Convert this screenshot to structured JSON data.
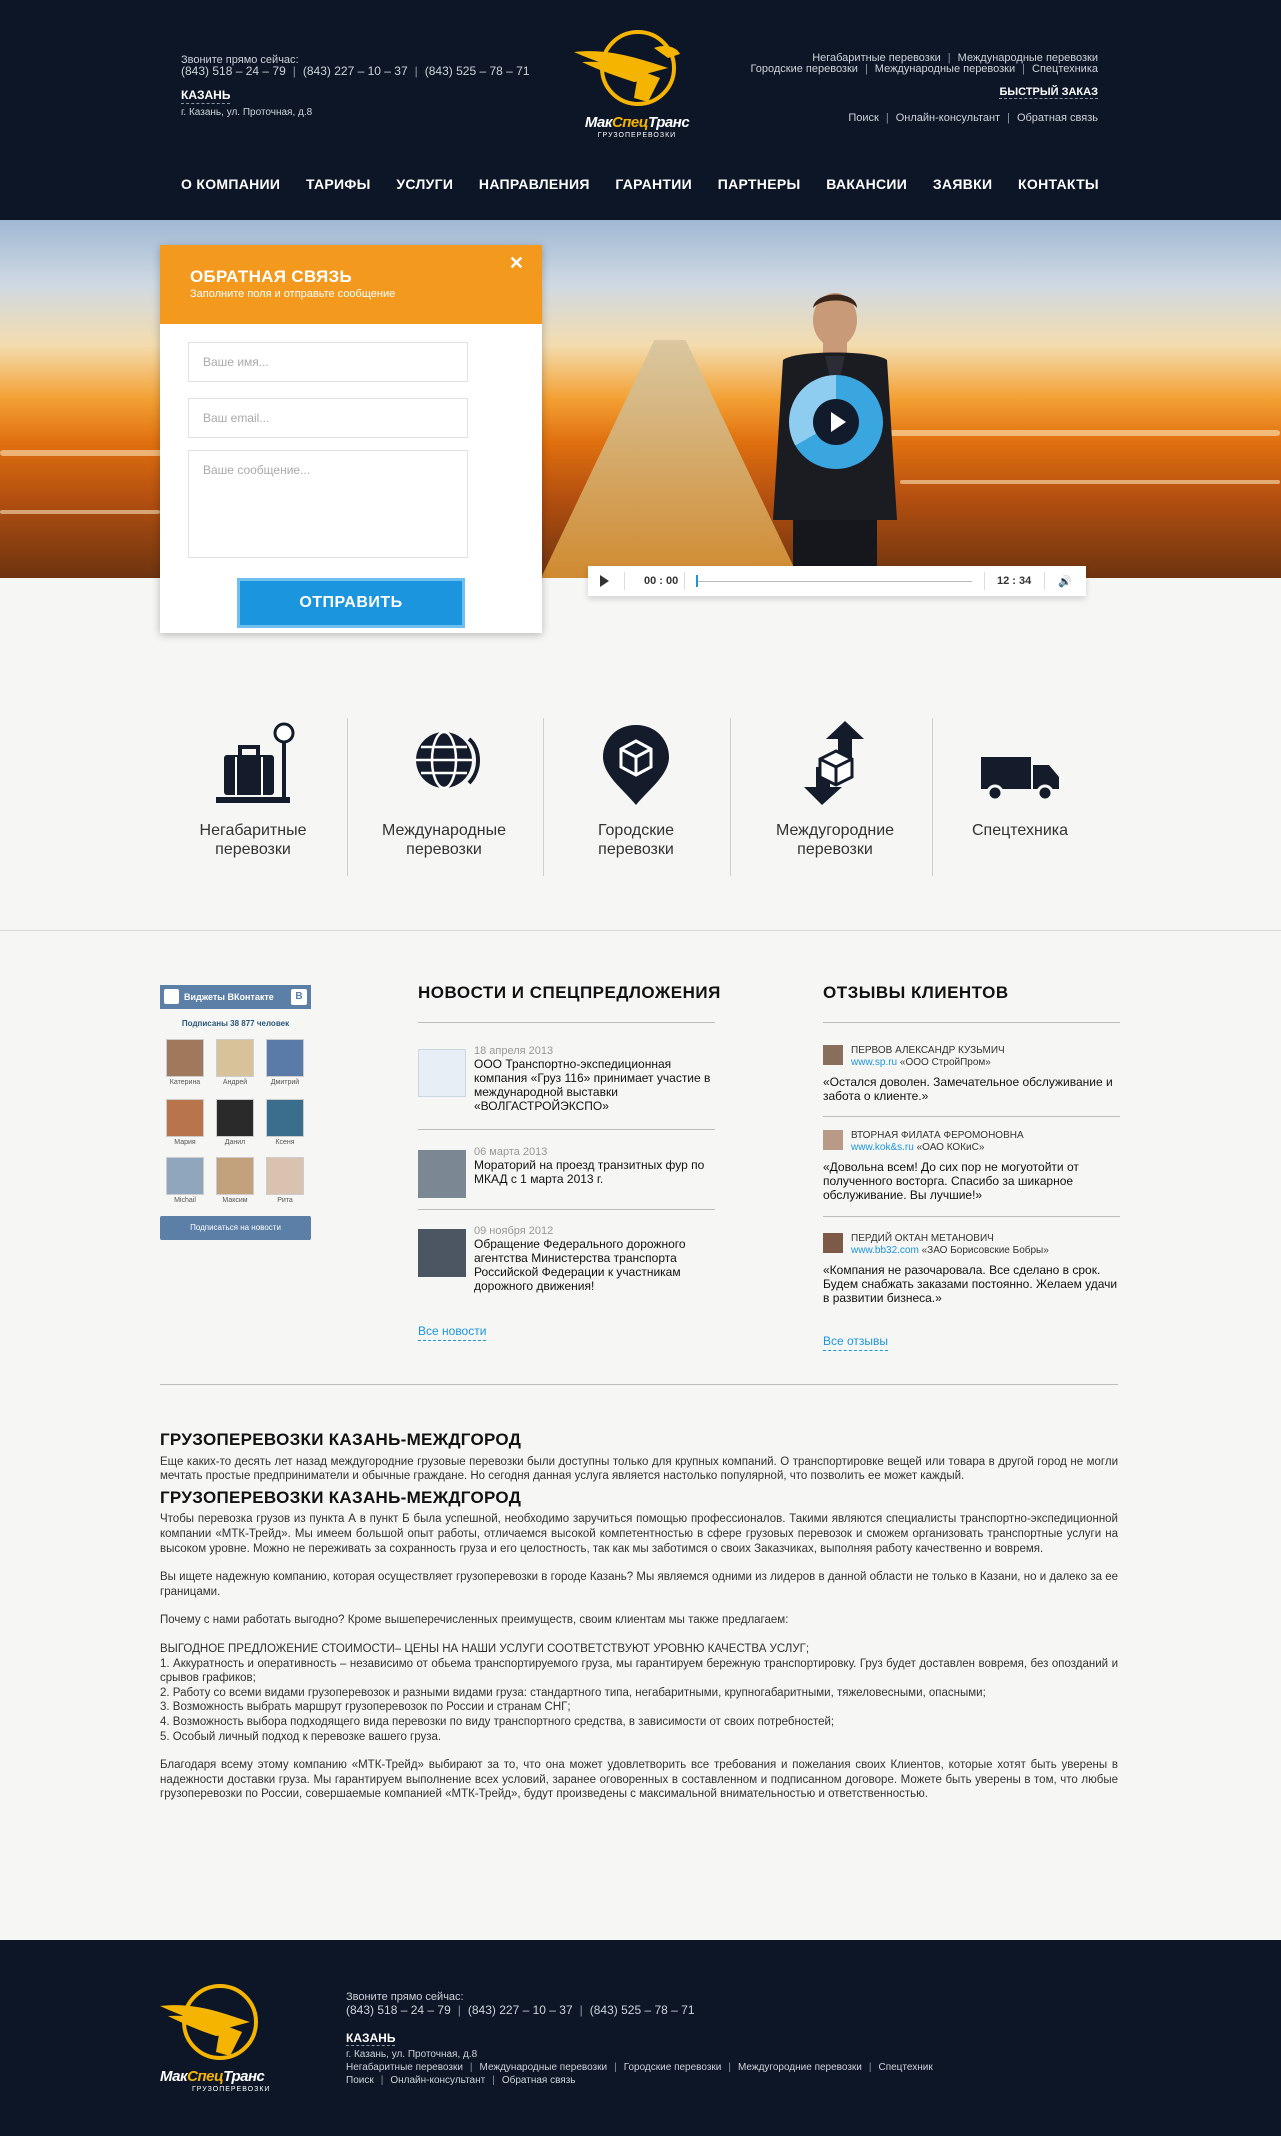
{
  "header": {
    "call_label": "Звоните прямо сейчас:",
    "phones": [
      "(843) 518 – 24 – 79",
      "(843) 227 – 10 – 37",
      "(843) 525 – 78 – 71"
    ],
    "city": "КАЗАНЬ",
    "address": "г. Казань, ул. Проточная, д.8",
    "logo": {
      "part1": "Мак",
      "part2": "Спец",
      "part3": "Транс",
      "sub": "ГРУЗОПЕРЕВОЗКИ"
    },
    "top_links_row1": [
      "Негабаритные перевозки",
      "Международные перевозки"
    ],
    "top_links_row2": [
      "Городские перевозки",
      "Международные перевозки",
      "Спецтехника"
    ],
    "quick_order": "БЫСТРЫЙ ЗАКАЗ",
    "top_links_row3": [
      "Поиск",
      "Онлайн-консультант",
      "Обратная связь"
    ]
  },
  "nav": [
    "О КОМПАНИИ",
    "ТАРИФЫ",
    "УСЛУГИ",
    "НАПРАВЛЕНИЯ",
    "ГАРАНТИИ",
    "ПАРТНЕРЫ",
    "ВАКАНСИИ",
    "ЗАЯВКИ",
    "КОНТАКТЫ"
  ],
  "feedback": {
    "title": "ОБРАТНАЯ СВЯЗЬ",
    "subtitle": "Заполните поля и отправьте сообщение",
    "name_placeholder": "Ваше имя...",
    "email_placeholder": "Ваш email...",
    "message_placeholder": "Ваше сообщение...",
    "send_label": "ОТПРАВИТЬ",
    "close_icon": "close-icon"
  },
  "player": {
    "current": "00 : 00",
    "total": "12 : 34",
    "progress": 0.0
  },
  "services": [
    {
      "label1": "Негабаритные",
      "label2": "перевозки",
      "icon": "luggage-scale-icon"
    },
    {
      "label1": "Международные",
      "label2": "перевозки",
      "icon": "globe-icon"
    },
    {
      "label1": "Городские",
      "label2": "перевозки",
      "icon": "map-pin-box-icon"
    },
    {
      "label1": "Междугородние",
      "label2": "перевозки",
      "icon": "box-arrows-icon"
    },
    {
      "label1": "Спецтехника",
      "label2": "",
      "icon": "truck-icon"
    }
  ],
  "vk": {
    "title": "Виджеты ВКонтакте",
    "count": "Подписаны 38 877 человек",
    "users": [
      "Катерина",
      "Андрей",
      "Дмитрий",
      "Мария",
      "Данил",
      "Ксеня",
      "Michail",
      "Максим",
      "Рита"
    ],
    "subscribe": "Подписаться на новости"
  },
  "news": {
    "title": "НОВОСТИ И СПЕЦПРЕДЛОЖЕНИЯ",
    "items": [
      {
        "date": "18 апреля 2013",
        "text": "ООО Транспортно-экспедиционная компания «Груз 116» принимает участие в международной выставки «ВОЛГАСТРОЙЭКСПО»"
      },
      {
        "date": "06 марта 2013",
        "text": "Мораторий на проезд транзитных фур по МКАД с 1 марта 2013 г."
      },
      {
        "date": "09 ноября 2012",
        "text": "Обращение Федерального дорожного агентства Министерства транспорта Российской Федерации к участникам дорожного движения!"
      }
    ],
    "all_link": "Все новости"
  },
  "reviews": {
    "title": "ОТЗЫВЫ КЛИЕНТОВ",
    "items": [
      {
        "name": "ПЕРВОВ АЛЕКСАНДР КУЗЬМИЧ",
        "site": "www.sp.ru",
        "company": "«ООО СтройПром»",
        "text": "«Остался доволен. Замечательное обслуживание и забота о клиенте.»"
      },
      {
        "name": "ВТОРНАЯ ФИЛАТА ФЕРОМОНОВНА",
        "site": "www.kok&s.ru",
        "company": "«ОАО КОКиС»",
        "text": "«Довольна всем! До сих пор не могуотойти от полученного восторга. Спасибо за шикарное обслуживание. Вы лучшие!»"
      },
      {
        "name": "ПЕРДИЙ ОКТАН МЕТАНОВИЧ",
        "site": "www.bb32.com",
        "company": "«ЗАО Борисовские Бобры»",
        "text": "«Компания не разочаровала. Все сделано в срок. Будем снабжать заказами постоянно. Желаем удачи в развитии бизнеса.»"
      }
    ],
    "all_link": "Все отзывы"
  },
  "seo": {
    "h1": "ГРУЗОПЕРЕВОЗКИ КАЗАНЬ-МЕЖДГОРОД",
    "p1": "Еще каких-то десять лет назад междугородние грузовые перевозки были доступны только для крупных компаний. О транспортировке вещей или товара в другой город не могли мечтать простые предприниматели и обычные граждане. Но сегодня данная услуга является настолько популярной, что позволить ее может каждый.",
    "h2": "ГРУЗОПЕРЕВОЗКИ КАЗАНЬ-МЕЖДГОРОД",
    "p2": "Чтобы перевозка грузов из пункта А в пункт Б была успешной, необходимо заручиться помощью профессионалов. Такими являются специалисты транспортно-экспедиционной компании «МТК-Трейд». Мы имеем большой опыт работы, отличаемся высокой компетентностью в сфере грузовых перевозок и сможем организовать транспортные услуги на высоком уровне. Можно не переживать за сохранность груза и его целостность, так как мы заботимся о своих Заказчиках, выполняя работу качественно и вовремя.",
    "p3": "Вы ищете надежную компанию, которая осуществляет грузоперевозки в городе Казань? Мы являемся одними из лидеров в данной области не только в Казани, но и далеко за ее границами.",
    "p4": "Почему с нами работать выгодно? Кроме вышеперечисленных преимуществ, своим клиентам мы также предлагаем:",
    "list_title": "ВЫГОДНОЕ ПРЕДЛОЖЕНИЕ СТОИМОСТИ– ЦЕНЫ НА НАШИ УСЛУГИ СООТВЕТСТВУЮТ УРОВНЮ КАЧЕСТВА УСЛУГ;",
    "list": [
      "1. Аккуратность и оперативность – независимо от обьема транспортируемого груза, мы гарантируем бережную транспортировку. Груз будет доставлен вовремя, без опозданий и срывов графиков;",
      "2. Работу со всеми видами грузоперевозок и разными видами груза: стандартного типа, негабаритными, крупногабаритными, тяжеловесными, опасными;",
      "3. Возможность выбрать маршрут грузоперевозок по России и странам СНГ;",
      "4. Возможность выбора подходящего вида перевозки по виду транспортного средства, в зависимости от своих потребностей;",
      "5. Особый личный подход к перевозке вашего груза."
    ],
    "p5": "Благодаря всему этому компанию «МТК-Трейд» выбирают за то, что она может удовлетворить все требования и пожелания своих Клиентов, которые хотят быть уверены в надежности доставки груза. Мы гарантируем выполнение всех условий, заранее оговоренных в составленном и подписанном договоре. Можете быть уверены в том, что любые грузоперевозки по России, совершаемые компанией «МТК-Трейд», будут произведены с максимальной внимательностью и ответственностью."
  },
  "footer": {
    "call_label": "Звоните прямо сейчас:",
    "phones": [
      "(843) 518 – 24 – 79",
      "(843) 227 – 10 – 37",
      "(843) 525 – 78 – 71"
    ],
    "city": "КАЗАНЬ",
    "address": "г. Казань, ул. Проточная, д.8",
    "links1": [
      "Негабаритные перевозки",
      "Международные перевозки",
      "Городские перевозки",
      "Междугородние перевозки",
      "Спецтехник"
    ],
    "links2": [
      "Поиск",
      "Онлайн-консультант",
      "Обратная связь"
    ]
  },
  "colors": {
    "header_bg": "#0c1627",
    "accent_orange": "#f39a1e",
    "accent_blue": "#1b95dd",
    "logo_yellow": "#f5b400",
    "vk_blue": "#5b7fa6"
  }
}
